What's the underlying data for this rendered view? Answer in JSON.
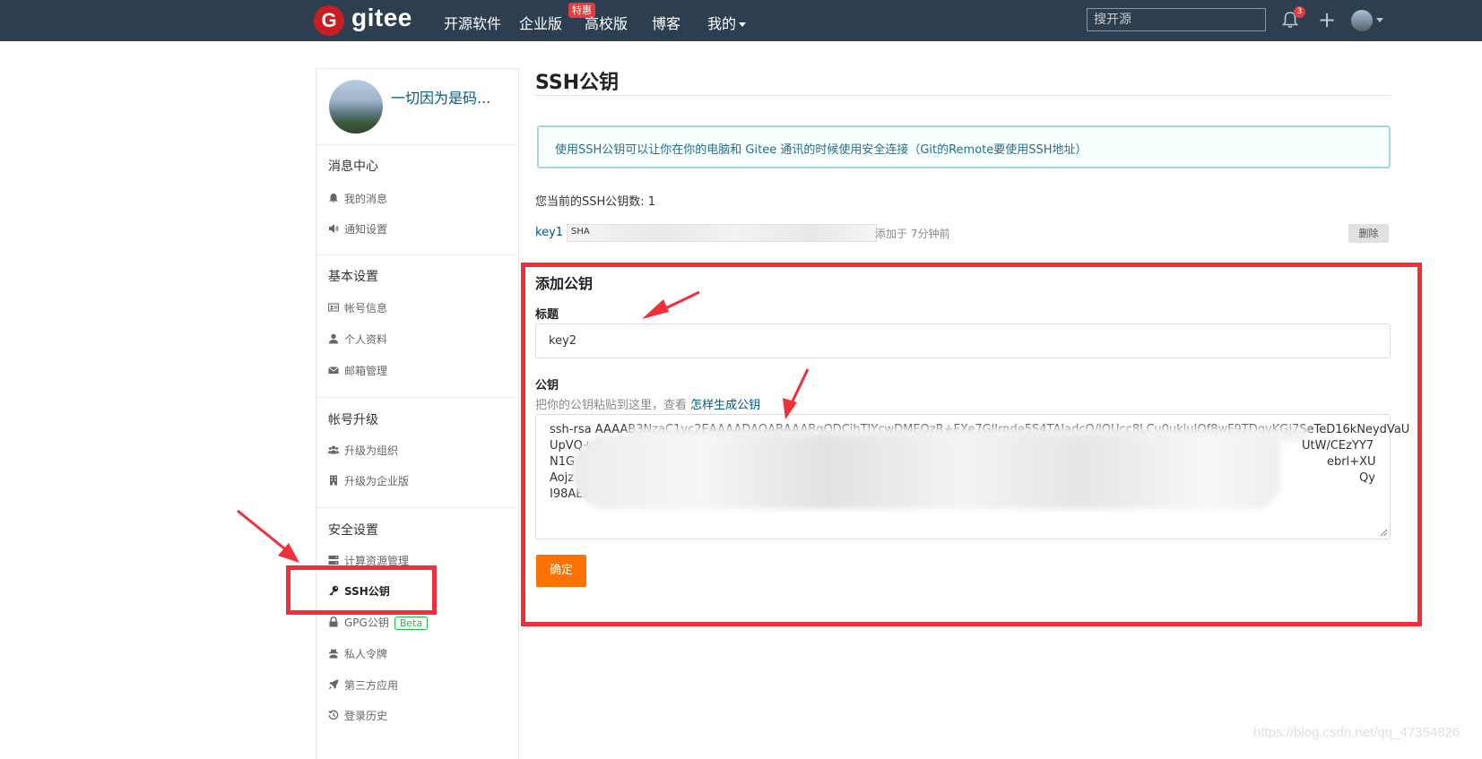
{
  "topnav": {
    "logo_letter": "G",
    "logo_text": "gitee",
    "items": [
      "开源软件",
      "企业版",
      "高校版",
      "博客",
      "我的"
    ],
    "enterprise_badge": "特惠",
    "search_placeholder": "搜开源",
    "notification_count": "3",
    "plus": "+"
  },
  "sidebar": {
    "user_name": "一切因为是码...",
    "sections": [
      {
        "title": "消息中心",
        "items": [
          "我的消息",
          "通知设置"
        ]
      },
      {
        "title": "基本设置",
        "items": [
          "帐号信息",
          "个人资料",
          "邮箱管理"
        ]
      },
      {
        "title": "帐号升级",
        "items": [
          "升级为组织",
          "升级为企业版"
        ]
      },
      {
        "title": "安全设置",
        "items": [
          "计算资源管理",
          "SSH公钥",
          "GPG公钥",
          "私人令牌",
          "第三方应用",
          "登录历史"
        ]
      }
    ],
    "beta_label": "Beta"
  },
  "main": {
    "title": "SSH公钥",
    "info": "使用SSH公钥可以让你在你的电脑和 Gitee 通讯的时候使用安全连接（Git的Remote要使用SSH地址）",
    "count_text": "您当前的SSH公钥数: 1",
    "keys": [
      {
        "name": "key1",
        "fingerprint_prefix": "SHA",
        "added": "添加于 7分钟前",
        "delete": "删除"
      }
    ],
    "add_form": {
      "heading": "添加公钥",
      "title_label": "标题",
      "title_value": "key2",
      "key_label": "公钥",
      "hint": "把你的公钥粘贴到这里，查看",
      "hint_link": "怎样生成公钥",
      "key_lines": [
        "ssh-rsa AAAAB3NzaC1yc2EAAAADAQABAAABgQDCihTIYcwDMEOzR+FXe7GlIrnde5S4TAJadcO/lOUcc8LCu0ukjuIOf8wF9TDqvKGj7SeTeD16kNeydVaU",
        "UpVQ+aV",
        "N1G",
        "Aojz",
        "I98AExp4H2aQ"
      ],
      "key_line_tails": [
        "",
        "UtW/CEzYY7",
        "ebrl+XU",
        "Qy",
        ""
      ],
      "submit": "确定"
    }
  },
  "watermark": "https://blog.csdn.net/qq_47354826"
}
